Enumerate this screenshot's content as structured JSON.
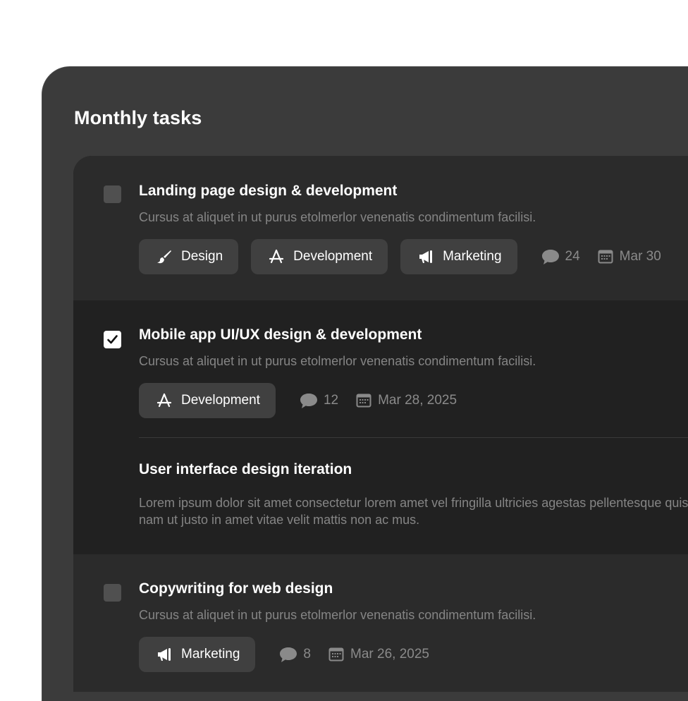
{
  "panel": {
    "title": "Monthly tasks"
  },
  "tasks": [
    {
      "title": "Landing page design & development",
      "description": "Cursus at aliquet in ut purus etolmerlor venenatis condimentum facilisi.",
      "checked": false,
      "tags": [
        {
          "label": "Design",
          "icon": "brush-icon"
        },
        {
          "label": "Development",
          "icon": "app-store-icon"
        },
        {
          "label": "Marketing",
          "icon": "megaphone-icon"
        }
      ],
      "comments": "24",
      "date": "Mar 30"
    },
    {
      "title": "Mobile app UI/UX design & development",
      "description": "Cursus at aliquet in ut purus etolmerlor venenatis condimentum facilisi.",
      "checked": true,
      "tags": [
        {
          "label": "Development",
          "icon": "app-store-icon"
        }
      ],
      "comments": "12",
      "date": "Mar 28, 2025",
      "subtask": {
        "title": "User interface design iteration",
        "description": "Lorem ipsum dolor sit amet consectetur lorem amet vel fringilla ultricies agestas pellentesque quis nam ut justo in amet vitae velit mattis non ac mus."
      }
    },
    {
      "title": "Copywriting for web design",
      "description": "Cursus at aliquet in ut purus etolmerlor venenatis condimentum facilisi.",
      "checked": false,
      "tags": [
        {
          "label": "Marketing",
          "icon": "megaphone-icon"
        }
      ],
      "comments": "8",
      "date": "Mar 26, 2025"
    }
  ],
  "colors": {
    "panel_bg": "#3b3b3b",
    "list_bg": "#2b2b2b",
    "selected_task_bg": "#212121",
    "tag_bg": "#404040",
    "muted_text": "#858585"
  }
}
